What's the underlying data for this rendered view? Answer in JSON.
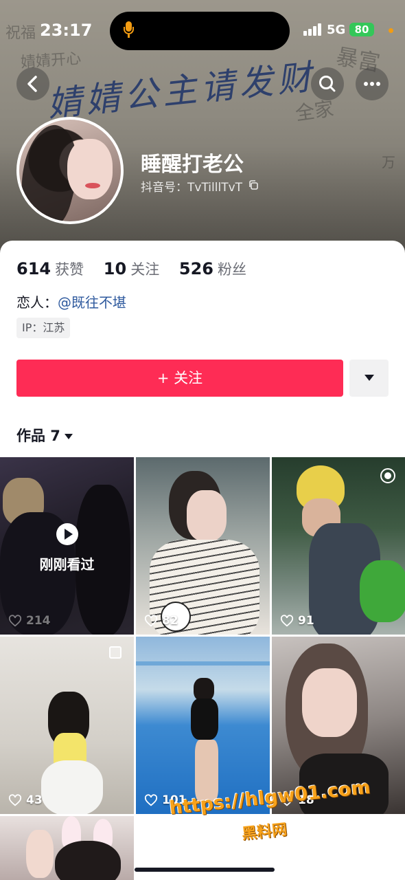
{
  "status_bar": {
    "time": "23:17",
    "network": "5G",
    "battery": "80",
    "battery_color": "#34c759",
    "mic_color": "#f39c12"
  },
  "cover": {
    "scrawl_text": "婧婧公主请发财",
    "side_texts": [
      "祝福",
      "婧婧开心",
      "全家",
      "暴富",
      "万"
    ]
  },
  "profile": {
    "nickname": "睡醒打老公",
    "douyin_id": "抖音号：TvTilllTvT",
    "stats": [
      {
        "value": "614",
        "label": "获赞"
      },
      {
        "value": "10",
        "label": "关注"
      },
      {
        "value": "526",
        "label": "粉丝"
      }
    ],
    "lover_label": "恋人：",
    "lover_mention": "@既往不堪",
    "ip_tag": "IP：江苏"
  },
  "actions": {
    "follow_label": "+ 关注",
    "follow_color": "#fe2c55"
  },
  "works": {
    "tab_label": "作品 7",
    "items": [
      {
        "likes": "214",
        "overlay": "刚刚看过",
        "watched": true
      },
      {
        "likes": "82"
      },
      {
        "likes": "91",
        "badge": "live-icon"
      },
      {
        "likes": "43",
        "badge": "pin-icon"
      },
      {
        "likes": "101"
      },
      {
        "likes": "18"
      },
      {
        "likes": ""
      }
    ]
  },
  "watermark": {
    "url": "https://hlgw01.com",
    "site": "黑料网"
  }
}
